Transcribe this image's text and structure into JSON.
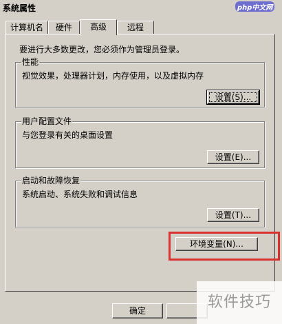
{
  "window": {
    "title": "系统属性"
  },
  "watermark_logo": "php中文网",
  "tabs": [
    {
      "label": "计算机名"
    },
    {
      "label": "硬件"
    },
    {
      "label": "高级",
      "active": true
    },
    {
      "label": "远程"
    }
  ],
  "advanced": {
    "intro": "要进行大多数更改，您必须作为管理员登录。",
    "performance": {
      "legend": "性能",
      "desc": "视觉效果，处理器计划，内存使用，以及虚拟内存",
      "button": "设置(S)..."
    },
    "user_profiles": {
      "legend": "用户配置文件",
      "desc": "与您登录有关的桌面设置",
      "button": "设置(E)..."
    },
    "startup_recovery": {
      "legend": "启动和故障恢复",
      "desc": "系统启动、系统失败和调试信息",
      "button": "设置(T)..."
    },
    "env_vars_button": "环境变量(N)..."
  },
  "footer": {
    "ok_button": "确定"
  },
  "watermark_text": "软件技巧",
  "colors": {
    "dialog_bg": "#d4d0c8",
    "highlight_border": "#d93030"
  }
}
